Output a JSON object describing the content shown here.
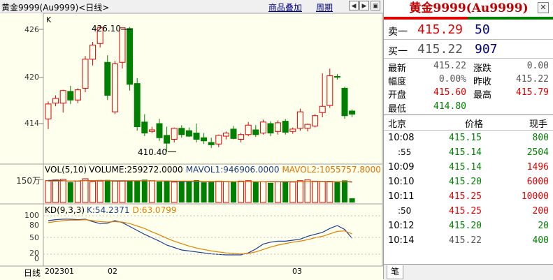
{
  "toolbar": {
    "title": "黄金9999(Au9999)<日线>",
    "overlay_label": "商品叠加",
    "cycle_label": "周期"
  },
  "main_chart": {
    "tag": "K",
    "y_ticks": [
      "426",
      "420",
      "414"
    ],
    "high_annotation": "426.10",
    "low_annotation": "410.40"
  },
  "volume_panel": {
    "legend_vol": "VOL(5,10)",
    "legend_volume": "VOLUME:259272.0000",
    "legend_mavol1": "MAVOL1:946906.0000",
    "legend_mavol2": "MAVOL2:1055757.8000",
    "y_tick": "150万"
  },
  "kd_panel": {
    "legend_kd": "KD(9,3,3)",
    "legend_k": "K:54.2371",
    "legend_d": "D:63.0799",
    "y_ticks": [
      "100",
      "80",
      "50",
      "20",
      "0"
    ]
  },
  "x_axis": {
    "mode": "日线",
    "labels": [
      "202301",
      "02",
      "03"
    ]
  },
  "quote": {
    "title": "黄金9999(Au9999)",
    "sell_label": "卖一",
    "sell_price": "415.29",
    "sell_vol": "50",
    "buy_label": "买一",
    "buy_price": "415.22",
    "buy_vol": "907",
    "stats": [
      {
        "label": "最新",
        "value": "415.22",
        "label2": "涨跌",
        "value2": "0.00"
      },
      {
        "label": "幅度",
        "value": "0.00%",
        "label2": "昨收",
        "value2": "415.22"
      },
      {
        "label": "开盘",
        "value": "415.60",
        "label2": "最高",
        "value2": "415.79"
      },
      {
        "label": "最低",
        "value": "414.80",
        "label2": "",
        "value2": ""
      }
    ]
  },
  "ticks": {
    "headers": [
      "北京",
      "价格",
      "现手"
    ],
    "rows": [
      {
        "time": "10:08",
        "price": "415.15",
        "vol": "800"
      },
      {
        "time": ":55",
        "price": "415.14",
        "vol": "2504"
      },
      {
        "time": "10:09",
        "price": "415.14",
        "vol": "1496"
      },
      {
        "time": "10:10",
        "price": "415.20",
        "vol": "6000"
      },
      {
        "time": "10:11",
        "price": "415.25",
        "vol": "10000"
      },
      {
        "time": ":50",
        "price": "415.25",
        "vol": "200"
      },
      {
        "time": "10:12",
        "price": "415.20",
        "vol": "20"
      },
      {
        "time": "10:14",
        "price": "415.22",
        "vol": "400"
      }
    ]
  },
  "bottom_tab": "笔",
  "colors": {
    "up": "#e00000",
    "down": "#008000",
    "mavol1": "#1a3d8f",
    "mavol2": "#e07000",
    "k_line": "#1a3d8f",
    "d_line": "#e08000"
  },
  "candles": [
    {
      "o": 414.6,
      "h": 416.8,
      "l": 413.3,
      "c": 416.5
    },
    {
      "o": 416.6,
      "h": 417.6,
      "l": 416.2,
      "c": 417.2
    },
    {
      "o": 416.6,
      "h": 418.3,
      "l": 415.4,
      "c": 418.2
    },
    {
      "o": 418.1,
      "h": 418.8,
      "l": 416.5,
      "c": 417.0
    },
    {
      "o": 417.0,
      "h": 418.5,
      "l": 416.6,
      "c": 418.3
    },
    {
      "o": 418.5,
      "h": 422.6,
      "l": 418.0,
      "c": 422.2
    },
    {
      "o": 422.2,
      "h": 424.4,
      "l": 421.4,
      "c": 424.0
    },
    {
      "o": 424.2,
      "h": 426.5,
      "l": 423.7,
      "c": 426.2
    },
    {
      "o": 421.8,
      "h": 422.7,
      "l": 417.0,
      "c": 417.6
    },
    {
      "o": 415.5,
      "h": 422.0,
      "l": 415.2,
      "c": 421.6
    },
    {
      "o": 421.8,
      "h": 426.0,
      "l": 421.0,
      "c": 426.2
    },
    {
      "o": 426.1,
      "h": 426.3,
      "l": 418.2,
      "c": 419.0
    },
    {
      "o": 419.1,
      "h": 419.8,
      "l": 413.1,
      "c": 413.6
    },
    {
      "o": 414.2,
      "h": 415.2,
      "l": 412.4,
      "c": 412.8
    },
    {
      "o": 413.0,
      "h": 413.6,
      "l": 412.8,
      "c": 413.2
    },
    {
      "o": 414.0,
      "h": 414.6,
      "l": 411.8,
      "c": 412.2
    },
    {
      "o": 412.5,
      "h": 413.6,
      "l": 410.4,
      "c": 411.5
    },
    {
      "o": 412.0,
      "h": 413.5,
      "l": 411.6,
      "c": 413.4
    },
    {
      "o": 413.4,
      "h": 413.8,
      "l": 412.2,
      "c": 412.6
    },
    {
      "o": 413.1,
      "h": 413.5,
      "l": 412.3,
      "c": 412.4
    },
    {
      "o": 412.8,
      "h": 414.0,
      "l": 411.6,
      "c": 412.0
    },
    {
      "o": 412.2,
      "h": 412.8,
      "l": 411.4,
      "c": 411.8
    },
    {
      "o": 411.6,
      "h": 412.2,
      "l": 410.9,
      "c": 411.3
    },
    {
      "o": 411.4,
      "h": 412.6,
      "l": 411.0,
      "c": 412.5
    },
    {
      "o": 412.4,
      "h": 413.0,
      "l": 412.0,
      "c": 412.8
    },
    {
      "o": 413.3,
      "h": 413.7,
      "l": 412.0,
      "c": 412.1
    },
    {
      "o": 412.0,
      "h": 412.8,
      "l": 411.6,
      "c": 412.6
    },
    {
      "o": 412.6,
      "h": 414.2,
      "l": 412.4,
      "c": 413.8
    },
    {
      "o": 413.2,
      "h": 413.8,
      "l": 412.3,
      "c": 412.6
    },
    {
      "o": 412.8,
      "h": 414.5,
      "l": 412.6,
      "c": 414.2
    },
    {
      "o": 414.0,
      "h": 414.3,
      "l": 412.4,
      "c": 412.8
    },
    {
      "o": 413.0,
      "h": 414.4,
      "l": 412.6,
      "c": 414.1
    },
    {
      "o": 414.3,
      "h": 414.6,
      "l": 412.6,
      "c": 412.9
    },
    {
      "o": 413.0,
      "h": 413.5,
      "l": 412.7,
      "c": 413.3
    },
    {
      "o": 413.4,
      "h": 415.9,
      "l": 413.1,
      "c": 415.5
    },
    {
      "o": 413.4,
      "h": 414.0,
      "l": 413.0,
      "c": 413.9
    },
    {
      "o": 413.7,
      "h": 415.2,
      "l": 413.5,
      "c": 415.0
    },
    {
      "o": 415.4,
      "h": 420.4,
      "l": 414.8,
      "c": 416.2
    },
    {
      "o": 416.3,
      "h": 421.0,
      "l": 416.0,
      "c": 420.1
    },
    {
      "o": 420.0,
      "h": 420.3,
      "l": 419.6,
      "c": 419.9
    },
    {
      "o": 418.5,
      "h": 418.7,
      "l": 414.6,
      "c": 415.0
    },
    {
      "o": 415.6,
      "h": 415.8,
      "l": 414.8,
      "c": 415.2
    }
  ],
  "volumes": [
    0.92,
    0.95,
    0.98,
    0.85,
    0.9,
    1.0,
    0.88,
    0.9,
    0.95,
    0.9,
    0.92,
    0.92,
    0.9,
    0.96,
    0.92,
    0.88,
    0.9,
    0.86,
    0.88,
    0.9,
    0.94,
    0.85,
    0.86,
    0.9,
    0.88,
    0.87,
    0.9,
    0.92,
    0.86,
    0.88,
    0.83,
    0.87,
    0.9,
    0.86,
    0.92,
    0.95,
    0.9,
    0.88,
    0.87,
    0.86,
    0.93,
    0.18
  ],
  "mavol1": [
    0.93,
    0.93,
    0.92,
    0.9,
    0.91,
    0.93,
    0.92,
    0.93,
    0.92,
    0.9,
    0.9,
    0.91,
    0.91,
    0.91,
    0.91,
    0.91,
    0.9,
    0.89,
    0.88,
    0.88,
    0.89,
    0.88,
    0.88,
    0.88,
    0.88,
    0.88,
    0.88,
    0.88,
    0.88,
    0.88,
    0.87,
    0.87,
    0.87,
    0.87,
    0.88,
    0.88,
    0.89,
    0.89,
    0.89,
    0.88,
    0.88,
    0.86
  ],
  "mavol2": [
    0.9,
    0.9,
    0.91,
    0.91,
    0.91,
    0.92,
    0.92,
    0.92,
    0.92,
    0.92,
    0.92,
    0.92,
    0.92,
    0.92,
    0.91,
    0.91,
    0.91,
    0.9,
    0.9,
    0.9,
    0.9,
    0.89,
    0.89,
    0.89,
    0.89,
    0.88,
    0.88,
    0.88,
    0.88,
    0.88,
    0.88,
    0.88,
    0.88,
    0.88,
    0.88,
    0.88,
    0.88,
    0.88,
    0.88,
    0.88,
    0.88,
    0.88
  ],
  "kd_k": [
    90,
    92,
    93,
    93,
    92,
    93,
    88,
    84,
    85,
    90,
    86,
    78,
    70,
    62,
    55,
    48,
    40,
    35,
    30,
    28,
    26,
    24,
    22,
    21,
    20,
    20,
    20,
    24,
    32,
    42,
    46,
    48,
    48,
    50,
    52,
    58,
    62,
    66,
    74,
    80,
    72,
    54
  ],
  "kd_d": [
    86,
    88,
    90,
    91,
    91,
    92,
    90,
    88,
    87,
    88,
    87,
    84,
    79,
    74,
    67,
    61,
    54,
    48,
    43,
    38,
    34,
    31,
    28,
    26,
    24,
    23,
    22,
    23,
    26,
    31,
    36,
    40,
    43,
    46,
    48,
    51,
    55,
    58,
    63,
    68,
    69,
    63
  ]
}
